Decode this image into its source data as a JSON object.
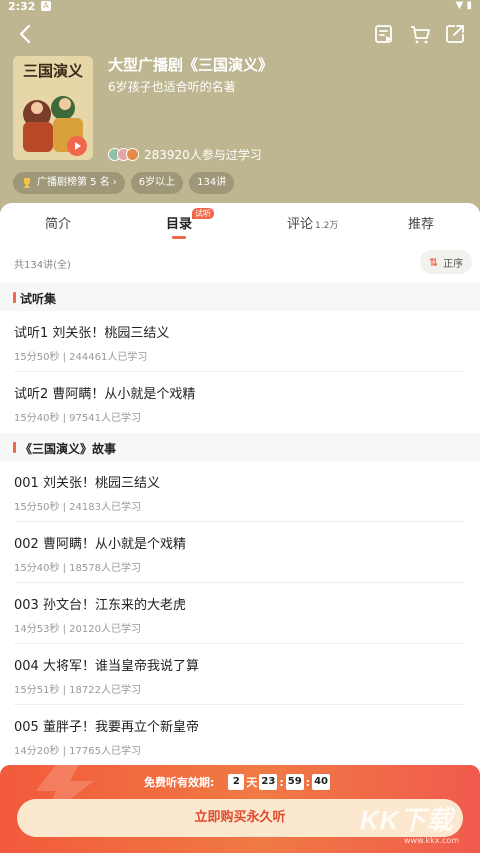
{
  "status_bar": {
    "time": "2:32",
    "notif_icon": "A"
  },
  "header": {
    "back_icon": "back-arrow-icon",
    "actions": [
      "playlist-icon",
      "cart-icon",
      "share-icon"
    ],
    "title": "大型广播剧《三国演义》",
    "subtitle": "6岁孩子也适合听的名著",
    "cover_text": "三国演义",
    "participants": "283920人参与过学习",
    "tags": [
      "广播剧榜第 5 名",
      "6岁以上",
      "134讲"
    ]
  },
  "tabs": {
    "intro": "简介",
    "catalog": "目录",
    "catalog_badge": "试听",
    "comments": "评论",
    "comments_count": "1.2万",
    "recommend": "推荐"
  },
  "list_header": {
    "total": "共134讲(全)",
    "sort": "正序"
  },
  "sections": [
    {
      "title": "试听集",
      "episodes": [
        {
          "title": "试听1  刘关张！桃园三结义",
          "meta": "15分50秒 | 244461人已学习"
        },
        {
          "title": "试听2  曹阿瞒！从小就是个戏精",
          "meta": "15分40秒 | 97541人已学习"
        }
      ]
    },
    {
      "title": "《三国演义》故事",
      "episodes": [
        {
          "title": "001 刘关张！桃园三结义",
          "meta": "15分50秒 | 24183人已学习"
        },
        {
          "title": "002 曹阿瞒！从小就是个戏精",
          "meta": "15分40秒 | 18578人已学习"
        },
        {
          "title": "003 孙文台！江东来的大老虎",
          "meta": "14分53秒 | 20120人已学习"
        },
        {
          "title": "004 大将军！谁当皇帝我说了算",
          "meta": "15分51秒 | 18722人已学习"
        },
        {
          "title": "005 董胖子！我要再立个新皇帝",
          "meta": "14分20秒 | 17765人已学习"
        }
      ]
    }
  ],
  "bottom": {
    "free_label": "免费听有效期:",
    "days": "2",
    "day_unit": "天",
    "hours": "23",
    "minutes": "59",
    "seconds": "40",
    "buy_label": "立即购买永久听"
  },
  "watermark": {
    "main": "KK下载",
    "sub": "www.kkx.com"
  },
  "colors": {
    "header_bg": "#bdb691",
    "accent": "#f0674c",
    "buy_bg": "#fbe8cf"
  }
}
